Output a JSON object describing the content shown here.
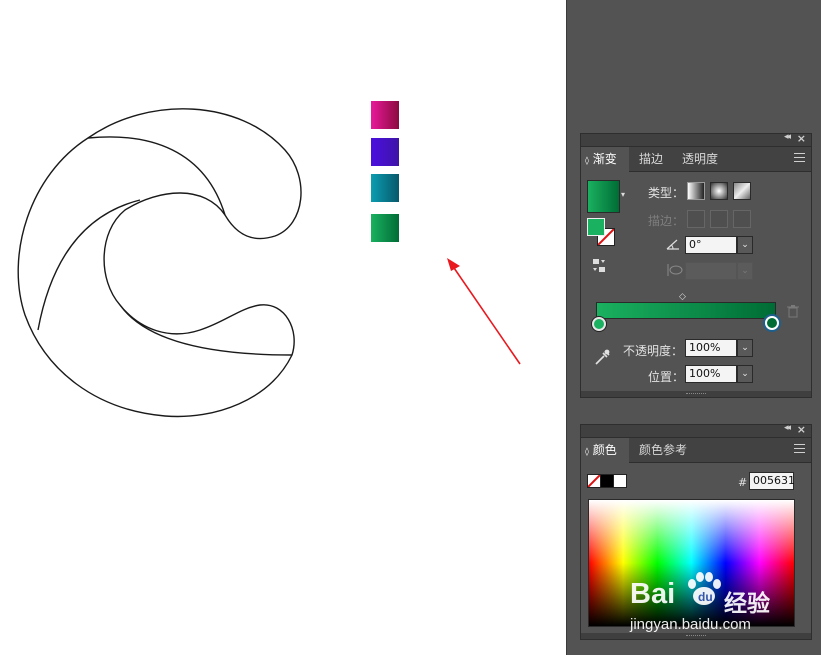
{
  "swatches": [
    {
      "name": "magenta",
      "from": "#e8199b",
      "to": "#8b0a3e"
    },
    {
      "name": "violet",
      "from": "#4b0fe0",
      "to": "#3e14a6"
    },
    {
      "name": "teal",
      "from": "#0b9db0",
      "to": "#07586b"
    },
    {
      "name": "green",
      "from": "#1ab160",
      "to": "#006c35"
    }
  ],
  "gradient_panel": {
    "tabs": [
      "渐变",
      "描边",
      "透明度"
    ],
    "type_label": "类型：",
    "stroke_label": "描边：",
    "angle_value": "0°",
    "opacity_label": "不透明度：",
    "opacity_value": "100%",
    "position_label": "位置：",
    "position_value": "100%",
    "gradient_from": "#1ab160",
    "gradient_to": "#006c35"
  },
  "color_panel": {
    "tabs": [
      "颜色",
      "颜色参考"
    ],
    "hash_label": "#",
    "hex_value": "005631"
  },
  "watermark": {
    "brand": "Bai",
    "brand_cn": "经验",
    "url": "jingyan.baidu.com"
  },
  "colors": {
    "arrow": "#e8191f",
    "dock_bg": "#535353"
  }
}
